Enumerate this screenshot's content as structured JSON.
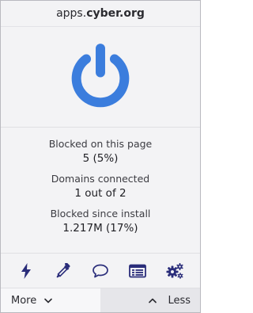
{
  "header": {
    "host_prefix": "apps.",
    "host_domain": "cyber.org"
  },
  "power": {
    "icon": "power-icon",
    "state": "on",
    "color": "#3b7ddd"
  },
  "stats": [
    {
      "label": "Blocked on this page",
      "value": "5 (5%)"
    },
    {
      "label": "Domains connected",
      "value": "1 out of 2"
    },
    {
      "label": "Blocked since install",
      "value": "1.217M (17%)"
    }
  ],
  "toolbar": {
    "icons": [
      "lightning-icon",
      "eyedropper-icon",
      "speech-bubble-icon",
      "logger-list-icon",
      "gears-icon"
    ],
    "icon_color": "#2a2d7a"
  },
  "footer": {
    "more_label": "More",
    "less_label": "Less"
  }
}
